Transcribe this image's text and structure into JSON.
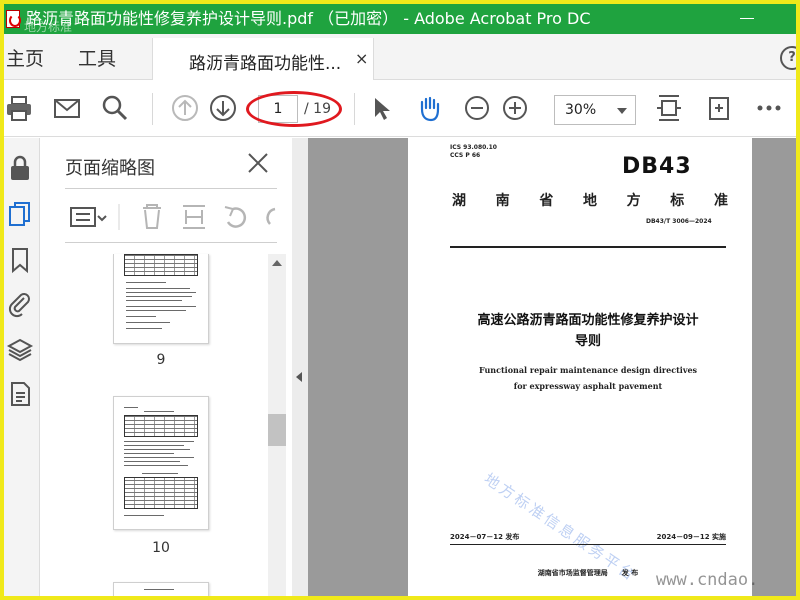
{
  "window": {
    "title": "路沥青路面功能性修复养护设计导则.pdf （已加密） - Adobe Acrobat Pro DC",
    "watermark_text": "地方标准"
  },
  "tabs": {
    "home": "主页",
    "tools": "工具",
    "document": "路沥青路面功能性...",
    "close": "×",
    "help": "?"
  },
  "toolbar": {
    "page_current": "1",
    "page_total": "/ 19",
    "zoom": "30%",
    "page_indicator_color": "#e0191f"
  },
  "panel": {
    "title": "页面缩略图",
    "thumbnails": [
      {
        "label": "9"
      },
      {
        "label": "10"
      }
    ]
  },
  "document_page": {
    "ics": "ICS 93.080.10",
    "ccs": "CCS P 66",
    "db_code": "DB43",
    "province_chars": [
      "湖",
      "南",
      "省",
      "地",
      "方",
      "标",
      "准"
    ],
    "standard_number": "DB43/T 3006—2024",
    "title_zh_line1": "高速公路沥青路面功能性修复养护设计",
    "title_zh_line2": "导则",
    "title_en_line1": "Functional repair maintenance design directives",
    "title_en_line2": "for expressway asphalt pavement",
    "stamp": "地方标准信息服务平台",
    "publish_date": "2024－07－12 发布",
    "implement_date": "2024－09－12 实施",
    "issuer": "湖南省市场监督管理局",
    "issuer_action": "发 布"
  },
  "site_watermark": "www.cndao."
}
